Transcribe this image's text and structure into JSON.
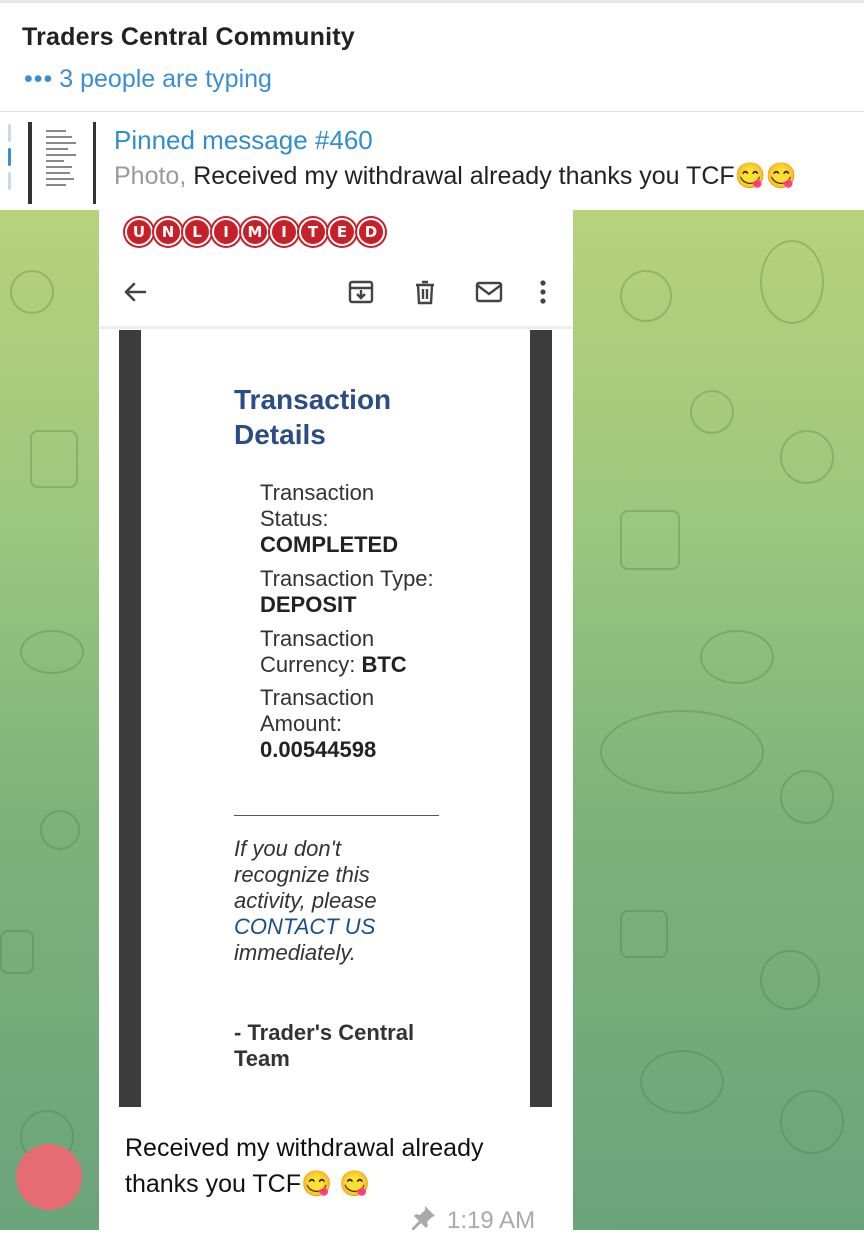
{
  "header": {
    "title": "Traders Central Community",
    "typing_dots": "•••",
    "typing_text": "3 people are typing"
  },
  "pinned": {
    "title": "Pinned message #460",
    "prefix": "Photo,",
    "text": " Received my withdrawal already thanks you TCF😋😋"
  },
  "photo": {
    "brand_letters": [
      "U",
      "N",
      "L",
      "I",
      "M",
      "I",
      "T",
      "E",
      "D"
    ],
    "icons": [
      "back-arrow-icon",
      "archive-icon",
      "delete-icon",
      "mail-icon",
      "more-vertical-icon"
    ]
  },
  "email": {
    "heading_line1": "Transaction",
    "heading_line2": "Details",
    "status_label_1": "Transaction",
    "status_label_2": "Status:",
    "status_value": "COMPLETED",
    "type_label": "Transaction Type:",
    "type_value": "DEPOSIT",
    "currency_label_1": "Transaction",
    "currency_label_2": "Currency: ",
    "currency_value": "BTC",
    "amount_label_1": "Transaction",
    "amount_label_2": "Amount:",
    "amount_value": "0.00544598",
    "note_1": "If you don't",
    "note_2": "recognize this",
    "note_3": "activity, please",
    "note_link": "CONTACT US",
    "note_4": "immediately.",
    "sign_1": "- Trader's Central",
    "sign_2": "Team"
  },
  "message": {
    "caption_line1": "Received my withdrawal already",
    "caption_line2": "thanks you TCF😋 😋",
    "time": "1:19 AM"
  },
  "colors": {
    "accent": "#3a8fd0",
    "brand_red": "#c8202a",
    "avatar": "#e66c74",
    "heading_blue": "#2b4c86"
  }
}
